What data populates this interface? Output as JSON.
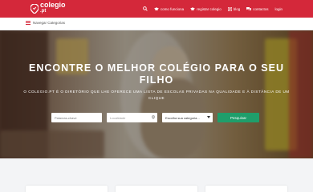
{
  "brand": {
    "name": "colegio",
    "domain": ".pt",
    "color": "#d4283a"
  },
  "nav": {
    "items": [
      {
        "icon": "graduation-cap-icon",
        "label": "como funciona"
      },
      {
        "icon": "graduation-cap-icon",
        "label": "registar colegio"
      },
      {
        "icon": "blog-icon",
        "label": "blog"
      },
      {
        "icon": "chat-icon",
        "label": "contactos"
      },
      {
        "icon": "",
        "label": "login"
      }
    ]
  },
  "breadcrumb": {
    "label": "Navegar Categorias"
  },
  "hero": {
    "title": "ENCONTRE O MELHOR COLÉGIO PARA O SEU FILHO",
    "subtitle": "O COLEGIO.PT É O DIRETÓRIO QUE LHE OFERECE UMA LISTA DE ESCOLAS PRIVADAS NA QUALIDADE E À DISTÂNCIA DE UM CLIQUE"
  },
  "search": {
    "name_placeholder": "Palavras-chave",
    "location_placeholder": "Localidade",
    "category_value": "Escolha sua categoria...",
    "submit_label": "Pesquisar",
    "submit_color": "#1f9e6b"
  }
}
